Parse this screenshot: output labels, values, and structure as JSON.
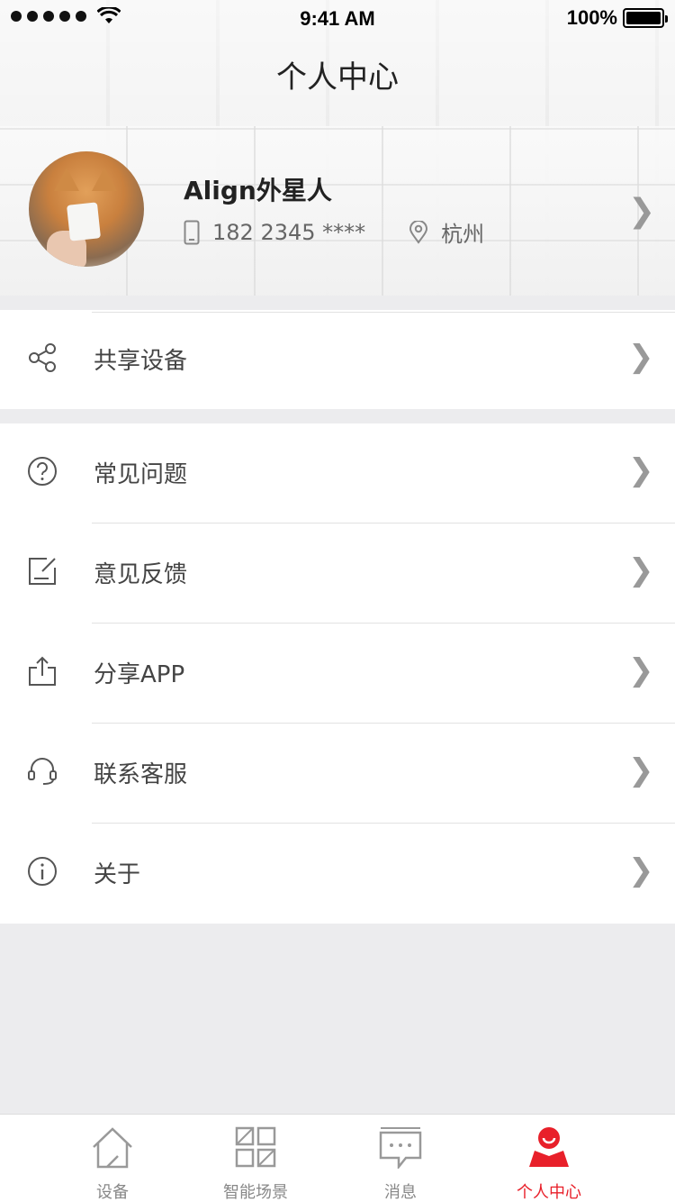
{
  "status_bar": {
    "time": "9:41 AM",
    "battery": "100%"
  },
  "header": {
    "title": "个人中心"
  },
  "profile": {
    "name": "Align外星人",
    "phone": "182 2345 ****",
    "city": "杭州"
  },
  "section_shared": [
    {
      "label": "共享设备",
      "icon": "share-nodes-icon"
    }
  ],
  "section_main": [
    {
      "label": "常见问题",
      "icon": "question-circle-icon"
    },
    {
      "label": "意见反馈",
      "icon": "feedback-edit-icon"
    },
    {
      "label": "分享APP",
      "icon": "share-upload-icon"
    },
    {
      "label": "联系客服",
      "icon": "headset-icon"
    },
    {
      "label": "关于",
      "icon": "info-circle-icon"
    }
  ],
  "tabbar": {
    "tabs": [
      {
        "label": "设备",
        "icon": "house-icon",
        "active": false
      },
      {
        "label": "智能场景",
        "icon": "grid-icon",
        "active": false
      },
      {
        "label": "消息",
        "icon": "chat-icon",
        "active": false
      },
      {
        "label": "个人中心",
        "icon": "person-icon",
        "active": true
      }
    ],
    "active_color": "#e8202a"
  }
}
